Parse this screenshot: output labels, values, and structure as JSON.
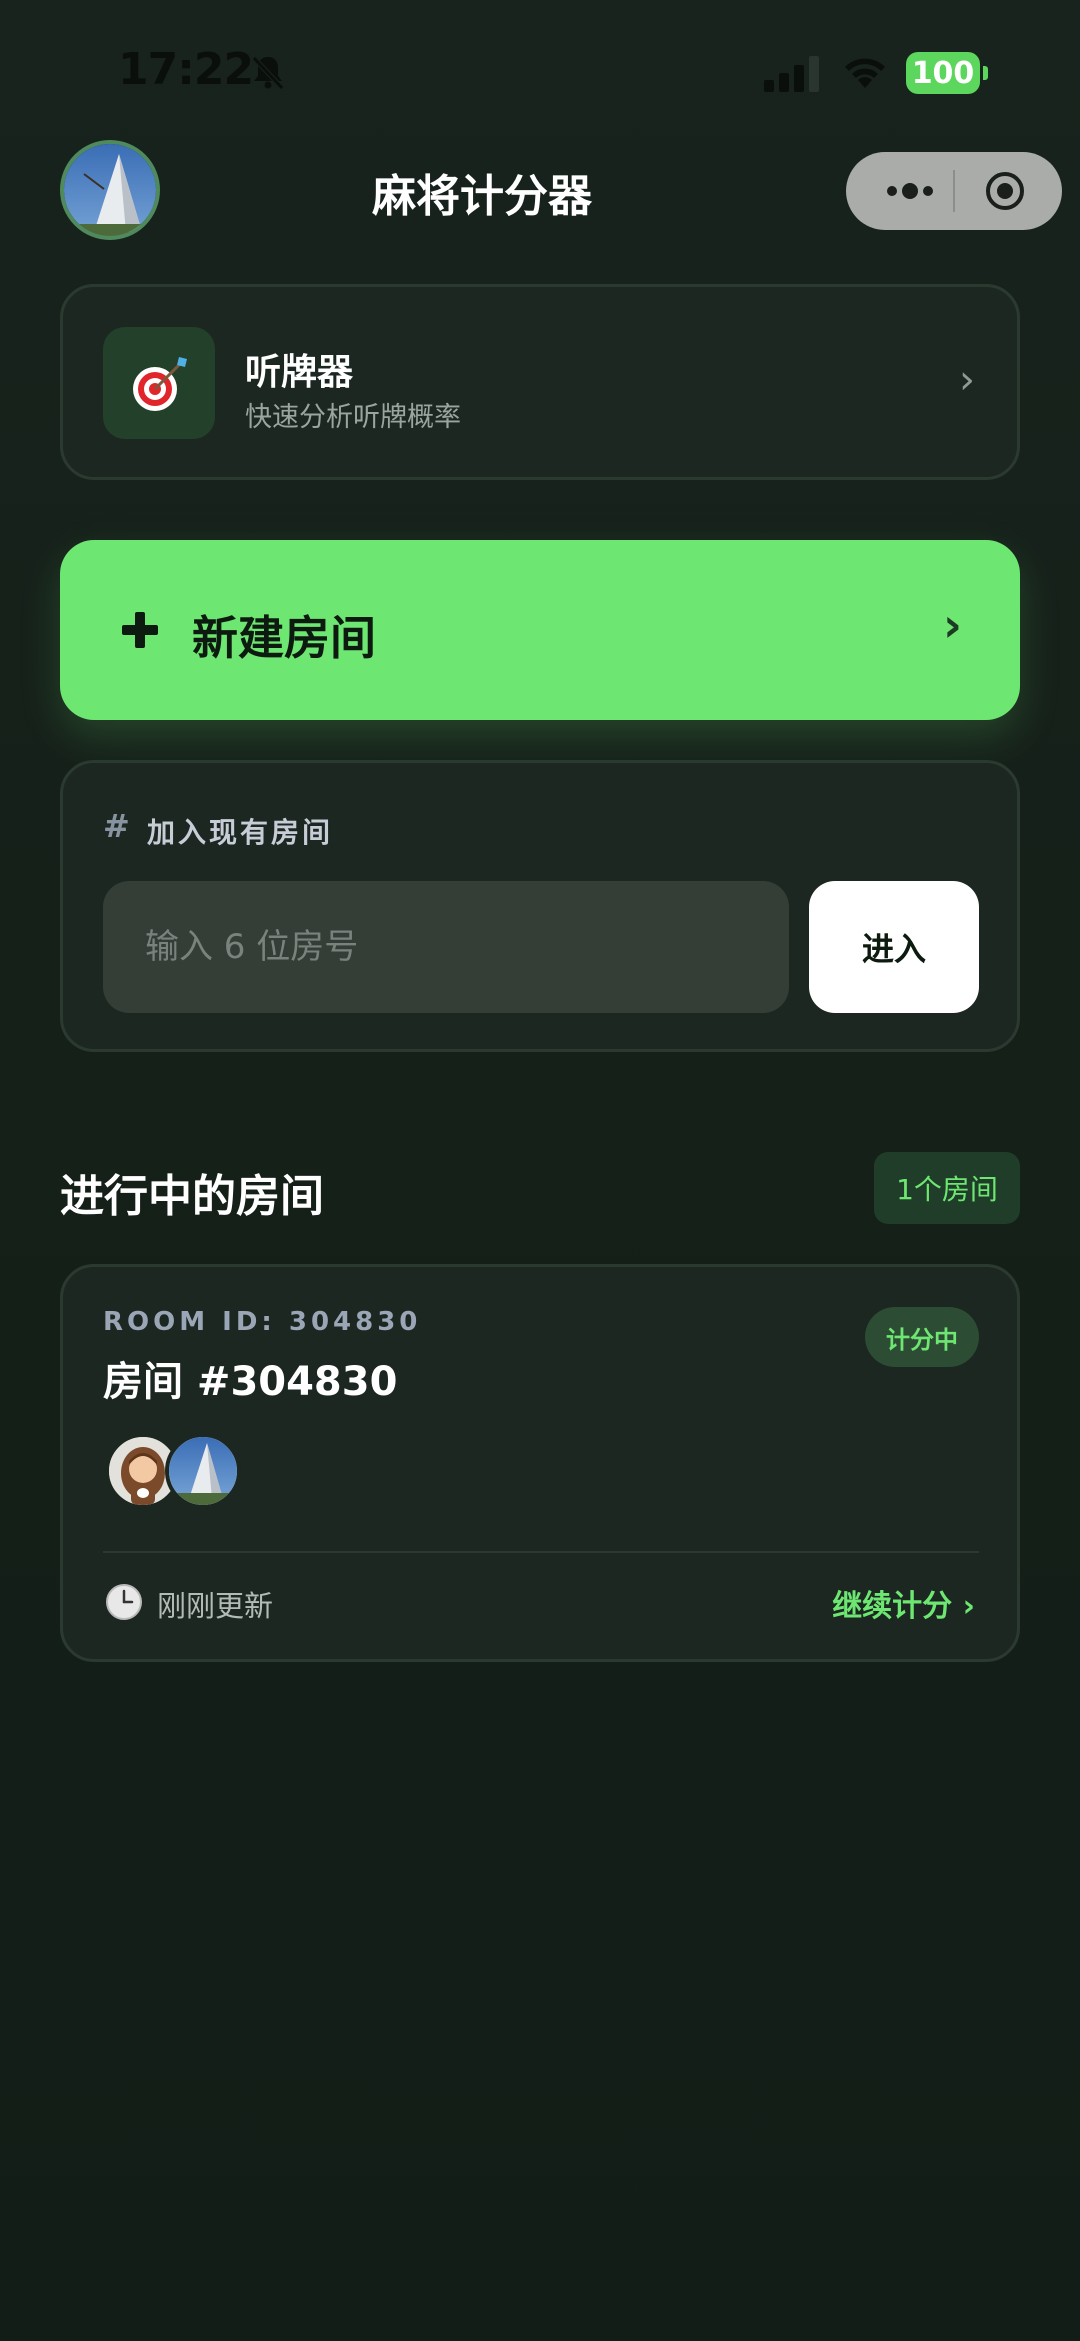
{
  "status_bar": {
    "time": "17:22",
    "battery": "100",
    "icons": [
      "bell-slash-icon",
      "signal-icon",
      "wifi-icon",
      "battery-icon"
    ]
  },
  "nav": {
    "title": "麻将计分器",
    "capsule_icons": [
      "more-icon",
      "target-icon"
    ]
  },
  "ting_card": {
    "title": "听牌器",
    "subtitle": "快速分析听牌概率",
    "chevron": "›",
    "icon": "dart-target-icon"
  },
  "new_room": {
    "plus": "+",
    "label": "新建房间",
    "chevron": "›"
  },
  "join": {
    "hash": "#",
    "title": "加入现有房间",
    "input_placeholder": "输入 6 位房号",
    "input_value": "",
    "button_label": "进入"
  },
  "active_rooms": {
    "title": "进行中的房间",
    "count_label": "1个房间",
    "rooms": [
      {
        "room_id_label": "ROOM ID: 304830",
        "name": "房间 #304830",
        "status": "计分中",
        "updated": "刚刚更新",
        "continue_label": "继续计分 ›"
      }
    ]
  },
  "colors": {
    "background": "#152019",
    "card": "#1b2720",
    "accent_green": "#6ee672",
    "badge_green_bg": "#1f3d28",
    "muted_text": "#9aa5a0"
  }
}
